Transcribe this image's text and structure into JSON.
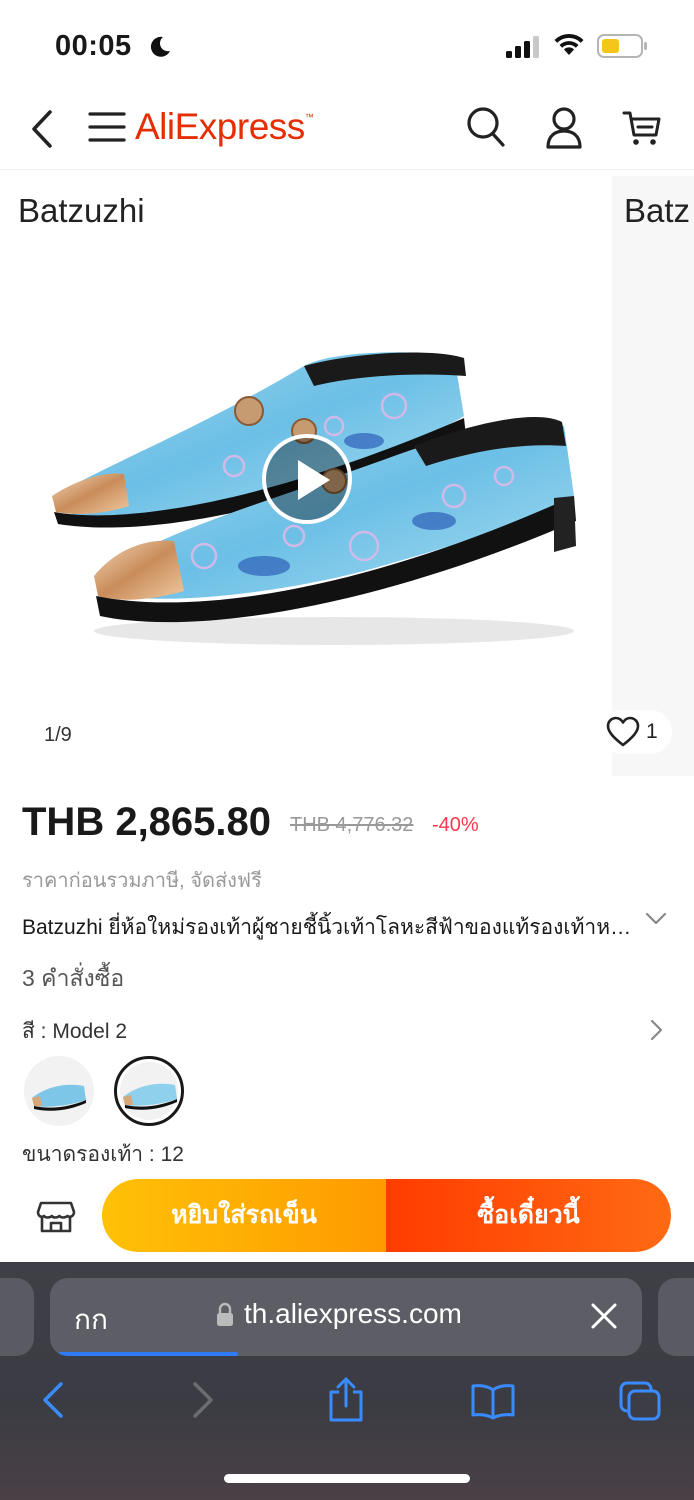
{
  "status_bar": {
    "time": "00:05",
    "icons": [
      "moon-icon",
      "signal-icon",
      "wifi-icon",
      "battery-icon"
    ]
  },
  "nav": {
    "logo": "AliExpress",
    "icons": [
      "back-icon",
      "menu-icon",
      "search-icon",
      "user-icon",
      "cart-icon"
    ],
    "logo_color": "#e62e04"
  },
  "gallery": {
    "brand_label": "Batzuzhi",
    "next_brand_label": "Batz",
    "counter": "1/9",
    "likes": "1"
  },
  "product": {
    "price": "THB 2,865.80",
    "original_price": "THB 4,776.32",
    "discount": "-40%",
    "tax_note": "ราคาก่อนรวมภาษี, จัดส่งฟรี",
    "title": "Batzuzhi ยี่ห้อใหม่รองเท้าผู้ชายชี้นิ้วเท้าโลหะสีฟ้าของแท้รองเท้าหนังผู้ชาย",
    "orders": "3 คำสั่งซื้อ",
    "color_label": "สี : Model 2",
    "size_label": "ขนาดรองเท้า : 12",
    "swatches": [
      "Model 1",
      "Model 2"
    ],
    "selected_swatch": "Model 2",
    "discount_color": "#fd384f"
  },
  "actions": {
    "add_to_cart": "หยิบใส่รถเข็น",
    "buy_now": "ซื้อเดี๋ยวนี้"
  },
  "safari": {
    "aa_label": "กก",
    "url": "th.aliexpress.com",
    "accent": "#2f7bf6"
  }
}
